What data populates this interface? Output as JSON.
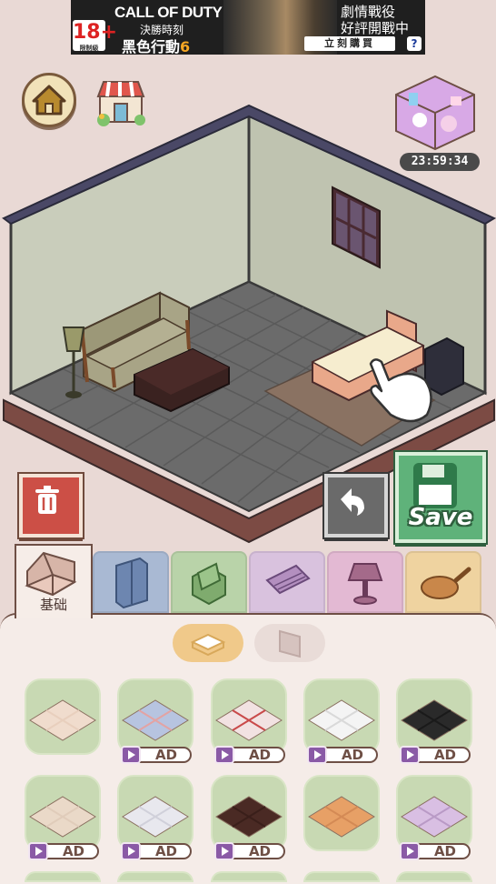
{
  "ad": {
    "age_rating": "18+",
    "age_note": "限制級",
    "brand": "CALL OF DUTY",
    "subtitle": "決勝時刻",
    "title_main": "黑色行動",
    "title_num": "6",
    "right_line1": "劇情戰役",
    "right_line2": "好評開戰中",
    "buy_label": "立刻購買",
    "help_label": "?"
  },
  "timer": "23:59:34",
  "save_label": "Save",
  "tabs": [
    {
      "label": "基础",
      "icon": "room-base-icon",
      "color": "#f6ede8",
      "active": true
    },
    {
      "label": "",
      "icon": "wardrobe-icon",
      "color": "#a9b9d3"
    },
    {
      "label": "",
      "icon": "armchair-icon",
      "color": "#b9d3a9"
    },
    {
      "label": "",
      "icon": "rug-roll-icon",
      "color": "#d9c2de"
    },
    {
      "label": "",
      "icon": "lamp-icon",
      "color": "#e3b9d3"
    },
    {
      "label": "",
      "icon": "frying-pan-icon",
      "color": "#efd3a0"
    }
  ],
  "segments": [
    {
      "icon": "floor-tile-icon",
      "active": true
    },
    {
      "icon": "wallpaper-icon",
      "active": false
    }
  ],
  "ad_label": "AD",
  "floors": [
    {
      "name": "floor-plain",
      "colors": [
        "#f0dccd",
        "#e8cfbd"
      ],
      "ad": false
    },
    {
      "name": "floor-blue-red",
      "colors": [
        "#b7c4e0",
        "#e3a3a3"
      ],
      "ad": true
    },
    {
      "name": "floor-red-pattern",
      "colors": [
        "#f2e2e2",
        "#c94a4a"
      ],
      "ad": true
    },
    {
      "name": "floor-white",
      "colors": [
        "#f4f4f4",
        "#d9d9d9"
      ],
      "ad": true
    },
    {
      "name": "floor-black",
      "colors": [
        "#2a2a2a",
        "#1a1a1a"
      ],
      "ad": true
    },
    {
      "name": "floor-beige",
      "colors": [
        "#ead9c8",
        "#e0ccba"
      ],
      "ad": true
    },
    {
      "name": "floor-gray-check",
      "colors": [
        "#e8e8ee",
        "#d0d0da"
      ],
      "ad": true
    },
    {
      "name": "floor-dark-wood",
      "colors": [
        "#4a2a24",
        "#3a1f1a"
      ],
      "ad": true
    },
    {
      "name": "floor-parquet",
      "colors": [
        "#e7a066",
        "#d48a55"
      ],
      "ad": false
    },
    {
      "name": "floor-lilac-weave",
      "colors": [
        "#d9bfe3",
        "#b99ac6"
      ],
      "ad": true
    }
  ]
}
